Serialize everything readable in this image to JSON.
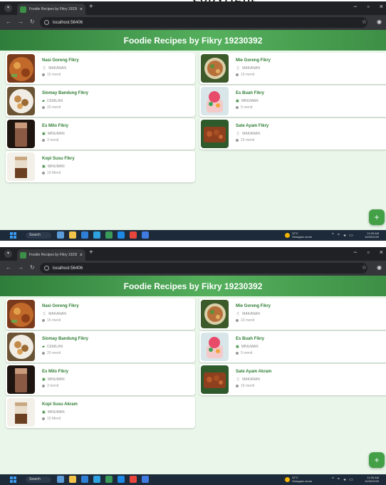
{
  "caption": {
    "text": "copyright"
  },
  "browser": {
    "tab_title": "Foodie Recipes by Fikry 19230…",
    "tab_close": "×",
    "new_tab": "+",
    "url": "localhost:56406",
    "window_controls": [
      "−",
      "▫",
      "×"
    ]
  },
  "app": {
    "title": "Foodie Recipes by Fikry 19230392",
    "fab_label": "+",
    "accent": "#2e7d32",
    "header_color": "#4caf50"
  },
  "screens": [
    {
      "recipes": [
        {
          "name": "Nasi Goreng Fikry",
          "category": "MAKANAN",
          "time": "15 menit",
          "icon": "utensils-icon"
        },
        {
          "name": "Mie Goreng Fikry",
          "category": "MAKANAN",
          "time": "10 menit",
          "icon": "utensils-icon"
        },
        {
          "name": "Siomay Bandung Fikry",
          "category": "CEMILAN",
          "time": "20 menit",
          "icon": "snack-icon"
        },
        {
          "name": "Es Buah Fikry",
          "category": "MINUMAN",
          "time": "5 menit",
          "icon": "cup-icon"
        },
        {
          "name": "Es Milo Fikry",
          "category": "MINUMAN",
          "time": "3 menit",
          "icon": "cup-icon"
        },
        {
          "name": "Sate Ayam Fikry",
          "category": "MAKANAN",
          "time": "15 menit",
          "icon": "utensils-icon"
        },
        {
          "name": "Kopi Susu Fikry",
          "category": "MINUMAN",
          "time": "10 Menit",
          "icon": "cup-icon"
        }
      ]
    },
    {
      "recipes": [
        {
          "name": "Nasi Goreng Fikry",
          "category": "MAKANAN",
          "time": "15 menit",
          "icon": "utensils-icon"
        },
        {
          "name": "Mie Goreng Fikry",
          "category": "MAKANAN",
          "time": "10 menit",
          "icon": "utensils-icon"
        },
        {
          "name": "Siomay Bandung Fikry",
          "category": "CEMILAN",
          "time": "20 menit",
          "icon": "snack-icon"
        },
        {
          "name": "Es Buah Fikry",
          "category": "MINUMAN",
          "time": "5 menit",
          "icon": "cup-icon"
        },
        {
          "name": "Es Milo Fikry",
          "category": "MINUMAN",
          "time": "3 menit",
          "icon": "cup-icon"
        },
        {
          "name": "Sate Ayam Akram",
          "category": "MAKANAN",
          "time": "15 menit",
          "icon": "utensils-icon"
        },
        {
          "name": "Kopi Susu Akram",
          "category": "MINUMAN",
          "time": "10 Menit",
          "icon": "cup-icon"
        }
      ]
    }
  ],
  "taskbar": {
    "search_label": "Search",
    "weather_temp": "32°C",
    "weather_desc": "Sebagian cerah",
    "time": "11:05 AM",
    "date": "10/30/2025"
  }
}
